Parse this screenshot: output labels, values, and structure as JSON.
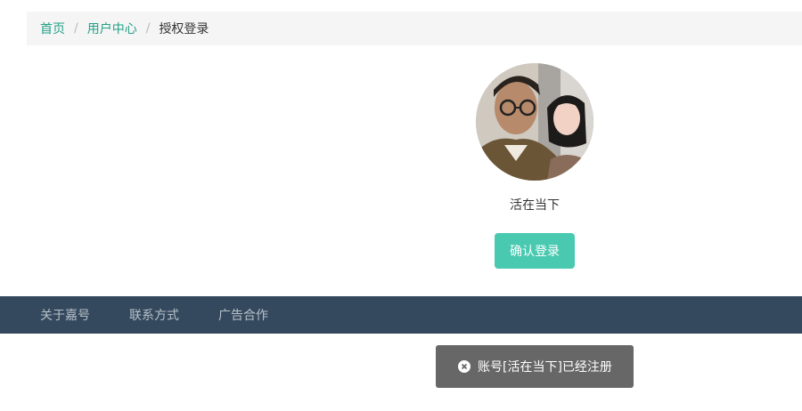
{
  "breadcrumb": {
    "home": "首页",
    "separator": "/",
    "user_center": "用户中心",
    "current": "授权登录"
  },
  "profile": {
    "avatar_icon": "user-avatar-photo",
    "username": "活在当下"
  },
  "actions": {
    "confirm_login_label": "确认登录"
  },
  "footer": {
    "links": [
      "关于嘉号",
      "联系方式",
      "广告合作"
    ]
  },
  "toast": {
    "icon": "close-circle-icon",
    "message": "账号[活在当下]已经注册"
  },
  "colors": {
    "link": "#22a187",
    "button": "#48c9b0",
    "footer_bg": "#34495e",
    "toast_bg": "#676767",
    "breadcrumb_bg": "#f5f5f5"
  }
}
